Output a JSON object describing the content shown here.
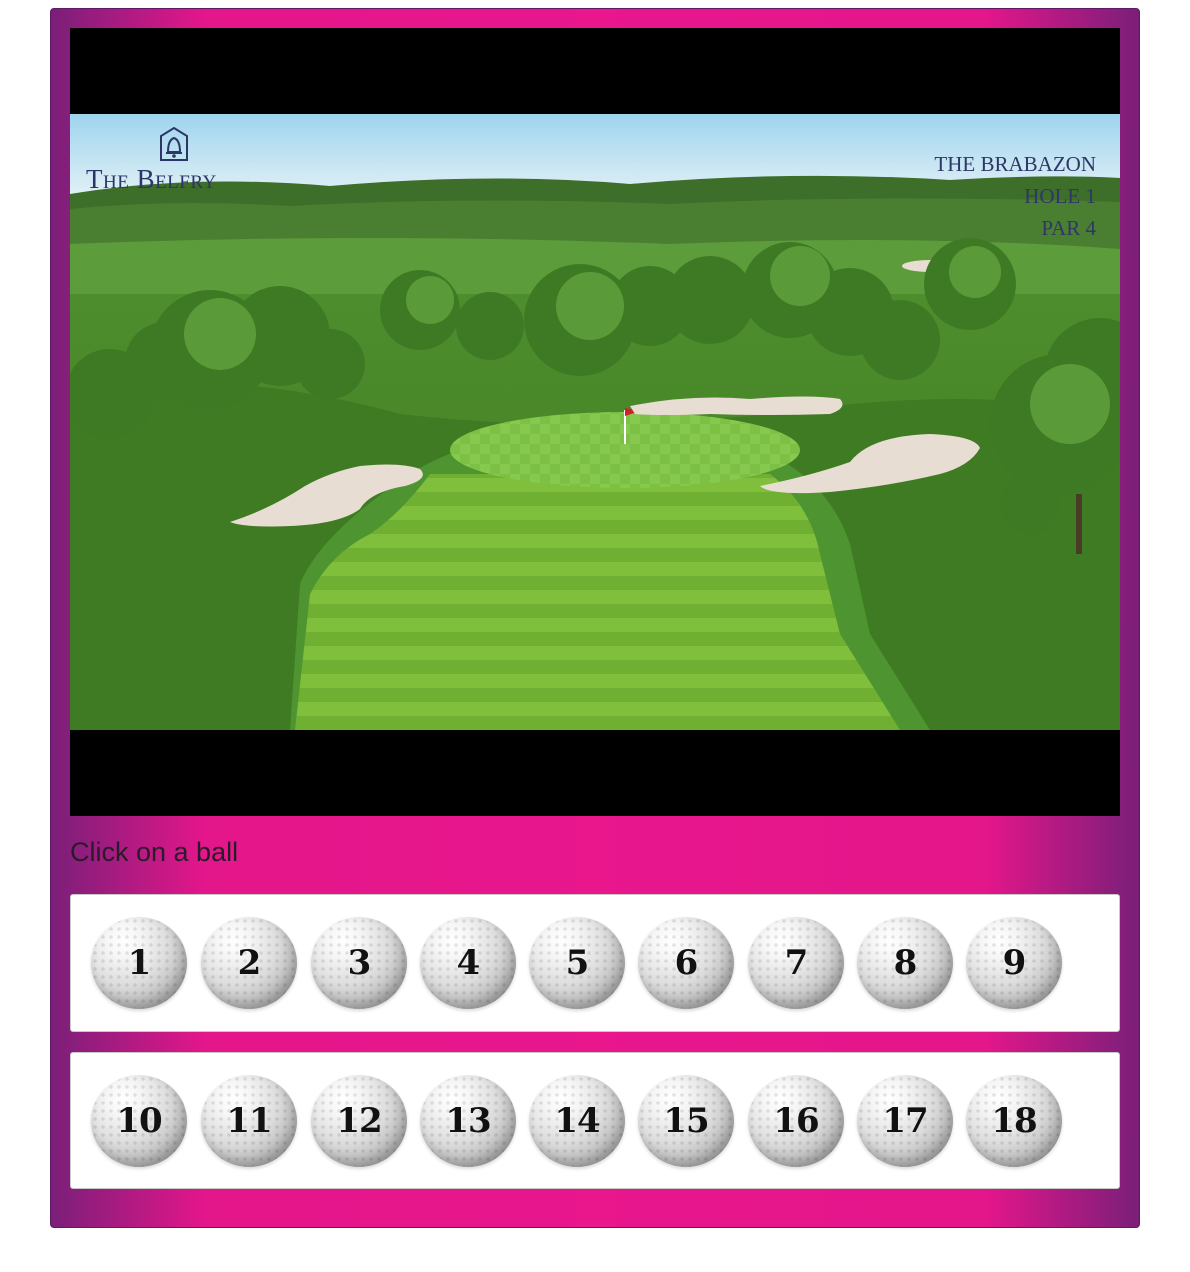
{
  "video": {
    "logo_text": "The Belfry",
    "course": "THE BRABAZON",
    "hole": "HOLE 1",
    "par": "PAR 4"
  },
  "prompt": "Click on a ball",
  "front_nine": [
    "1",
    "2",
    "3",
    "4",
    "5",
    "6",
    "7",
    "8",
    "9"
  ],
  "back_nine": [
    "10",
    "11",
    "12",
    "13",
    "14",
    "15",
    "16",
    "17",
    "18"
  ],
  "colors": {
    "frame_magenta": "#e9168c",
    "frame_purple": "#7a1f79"
  }
}
